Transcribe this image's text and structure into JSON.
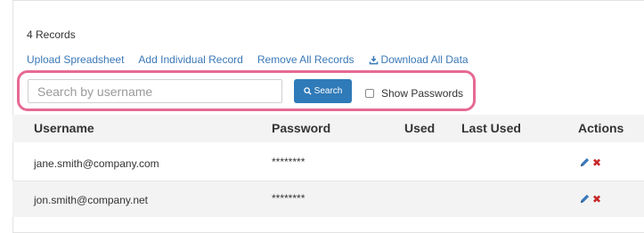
{
  "records_count": "4 Records",
  "links": {
    "upload": "Upload Spreadsheet",
    "add": "Add Individual Record",
    "remove": "Remove All Records",
    "download": "Download All Data"
  },
  "search": {
    "placeholder": "Search by username",
    "value": "",
    "button_label": "Search"
  },
  "show_passwords": {
    "label": "Show Passwords",
    "checked": false
  },
  "table": {
    "headers": [
      "Username",
      "Password",
      "Used",
      "Last Used",
      "Actions"
    ],
    "rows": [
      {
        "username": "jane.smith@company.com",
        "password": "********",
        "used": "",
        "last_used": ""
      },
      {
        "username": "jon.smith@company.net",
        "password": "********",
        "used": "",
        "last_used": ""
      }
    ]
  },
  "colors": {
    "link": "#3a78b8",
    "button": "#2f7ab8",
    "highlight": "#e66a92",
    "delete": "#c62828"
  },
  "icons": {
    "download": "download-icon",
    "search": "search-icon",
    "edit": "pencil-icon",
    "delete": "close-icon"
  }
}
